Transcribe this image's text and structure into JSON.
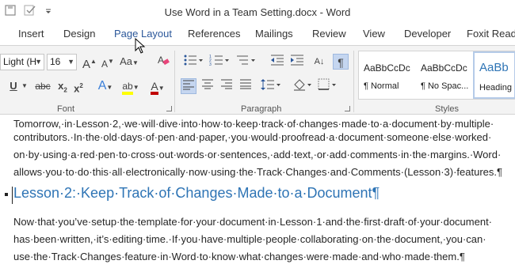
{
  "window": {
    "title": "Use Word in a Team Setting.docx - Word"
  },
  "qat": {
    "save_icon": "floppy-icon",
    "check_icon": "check-icon",
    "customize_icon": "dropdown-icon"
  },
  "tabs": [
    {
      "label": "Insert"
    },
    {
      "label": "Design"
    },
    {
      "label": "Page Layout"
    },
    {
      "label": "References"
    },
    {
      "label": "Mailings"
    },
    {
      "label": "Review"
    },
    {
      "label": "View"
    },
    {
      "label": "Developer"
    },
    {
      "label": "Foxit Reade"
    }
  ],
  "ribbon": {
    "font_name": "Light (H",
    "font_size": "16",
    "grow_font": "A",
    "shrink_font": "A",
    "change_case": "Aa",
    "underline": "U",
    "strikethrough": "abc",
    "subscript": "x",
    "subscript_small": "2",
    "superscript": "x",
    "superscript_small": "2",
    "text_effects": "A",
    "highlight": "ab",
    "font_color": "A",
    "font_group_label": "Font",
    "paragraph_group_label": "Paragraph",
    "styles_group_label": "Styles",
    "show_marks": "¶",
    "sort": "A↓",
    "styles": [
      {
        "preview": "AaBbCcDc",
        "name": "¶ Normal"
      },
      {
        "preview": "AaBbCcDc",
        "name": "¶ No Spac..."
      },
      {
        "preview": "AaBb",
        "name": "Heading"
      }
    ]
  },
  "document": {
    "para1_line1": "Tomorrow,·in·Lesson·2,·we·will·dive·into·how·to·keep·track·of·changes·made·to·a·document·by·multiple·",
    "para1_line2": "contributors.·In·the·old·days·of·pen·and·paper,·you·would·proofread·a·document·someone·else·worked·",
    "para1_line3": "on·by·using·a·red·pen·to·cross·out·words·or·sentences,·add·text,·or·add·comments·in·the·margins.·Word·",
    "para1_line4": "allows·you·to·do·this·all·electronically·now·using·the·Track·Changes·and·Comments·(Lesson·3)·features.¶",
    "heading": "Lesson·2:·Keep·Track·of·Changes·Made·to·a·Document¶",
    "para2_line1": "Now·that·you’ve·setup·the·template·for·your·document·in·Lesson·1·and·the·first·draft·of·your·document·",
    "para2_line2": "has·been·written,·it’s·editing·time.·If·you·have·multiple·people·collaborating·on·the·document,·you·can·",
    "para2_line3": "use·the·Track·Changes·feature·in·Word·to·know·what·changes·were·made·and·who·made·them.¶"
  },
  "colors": {
    "accent": "#2b579a",
    "heading": "#2e74b5",
    "ribbon_bg": "#f3f3f3"
  }
}
